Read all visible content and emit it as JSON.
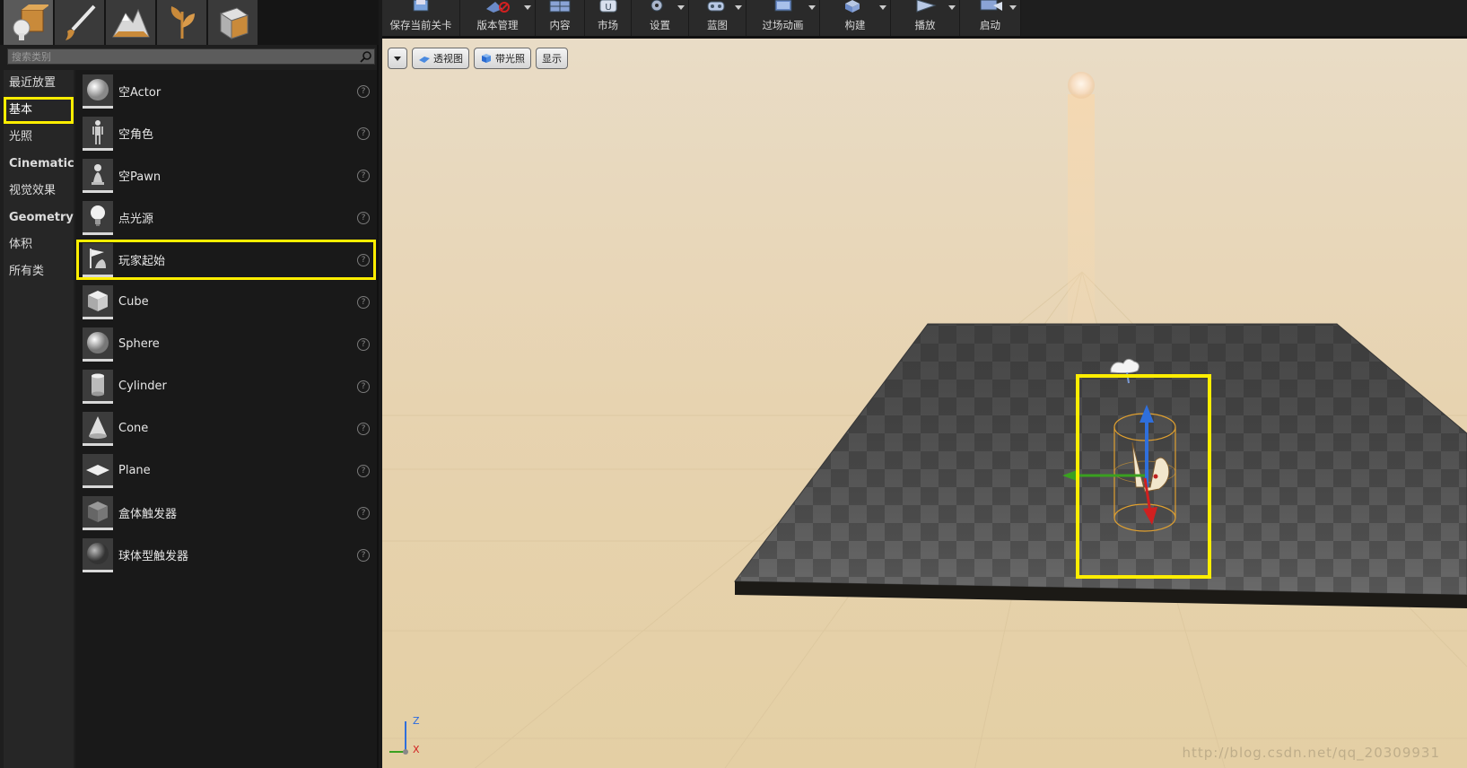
{
  "mode_tabs": [
    {
      "name": "place-mode",
      "icon": "place-actor-icon",
      "active": true
    },
    {
      "name": "paint-mode",
      "icon": "paint-brush-icon"
    },
    {
      "name": "landscape-mode",
      "icon": "landscape-mountain-icon"
    },
    {
      "name": "foliage-mode",
      "icon": "foliage-leaf-icon"
    },
    {
      "name": "geometry-mode",
      "icon": "geometry-box-icon"
    }
  ],
  "search": {
    "placeholder": "搜索类别"
  },
  "categories": [
    {
      "label": "最近放置"
    },
    {
      "label": "基本",
      "selected": true
    },
    {
      "label": "光照"
    },
    {
      "label": "Cinematic",
      "bold": true
    },
    {
      "label": "视觉效果"
    },
    {
      "label": "Geometry",
      "bold": true
    },
    {
      "label": "体积"
    },
    {
      "label": "所有类"
    }
  ],
  "items": [
    {
      "label": "空Actor",
      "icon": "sphere-icon"
    },
    {
      "label": "空角色",
      "icon": "character-icon"
    },
    {
      "label": "空Pawn",
      "icon": "pawn-icon"
    },
    {
      "label": "点光源",
      "icon": "light-bulb-icon"
    },
    {
      "label": "玩家起始",
      "icon": "player-start-icon",
      "selected": true
    },
    {
      "label": "Cube",
      "icon": "cube-icon"
    },
    {
      "label": "Sphere",
      "icon": "sphere-icon"
    },
    {
      "label": "Cylinder",
      "icon": "cylinder-icon"
    },
    {
      "label": "Cone",
      "icon": "cone-icon"
    },
    {
      "label": "Plane",
      "icon": "plane-icon"
    },
    {
      "label": "盒体触发器",
      "icon": "box-trigger-icon"
    },
    {
      "label": "球体型触发器",
      "icon": "sphere-trigger-icon"
    }
  ],
  "help_glyph": "?",
  "toolbar": [
    {
      "label": "保存当前关卡",
      "icon": "save-icon",
      "dropdown": false
    },
    {
      "label": "版本管理",
      "icon": "source-control-icon",
      "dropdown": true
    },
    {
      "label": "内容",
      "icon": "content-icon",
      "dropdown": false
    },
    {
      "label": "市场",
      "icon": "marketplace-icon",
      "dropdown": false
    },
    {
      "label": "设置",
      "icon": "settings-icon",
      "dropdown": true
    },
    {
      "label": "蓝图",
      "icon": "blueprint-icon",
      "dropdown": true
    },
    {
      "label": "过场动画",
      "icon": "cinematics-icon",
      "dropdown": true
    },
    {
      "label": "构建",
      "icon": "build-icon",
      "dropdown": true
    },
    {
      "label": "播放",
      "icon": "play-icon",
      "dropdown": true
    },
    {
      "label": "启动",
      "icon": "launch-icon",
      "dropdown": true
    }
  ],
  "viewport": {
    "perspective": "透视图",
    "lit": "带光照",
    "show": "显示",
    "axis_z": "Z",
    "axis_x": "X",
    "watermark": "http://blog.csdn.net/qq_20309931"
  },
  "colors": {
    "highlight": "#ffee00",
    "sky_top": "#e8d8bf",
    "sky_bottom": "#e6d0a5",
    "floor_dark": "#4a4a4a",
    "floor_light": "#6a6a6a"
  }
}
